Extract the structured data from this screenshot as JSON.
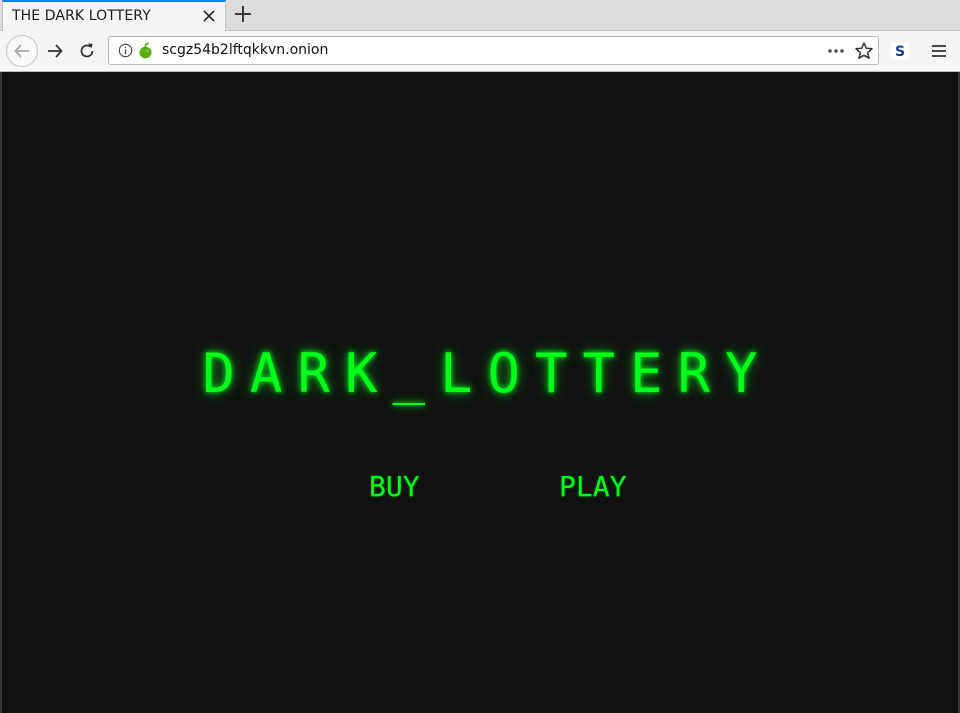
{
  "browser": {
    "tab": {
      "title": "THE DARK LOTTERY"
    },
    "address_bar": {
      "url": "scgz54b2lftqkkvn.onion"
    },
    "extension_label": "S",
    "icons": {
      "close": "close-icon",
      "new_tab": "plus-icon",
      "back": "arrow-left-icon",
      "forward": "arrow-right-icon",
      "reload": "reload-icon",
      "info": "info-icon",
      "onion": "onion-icon",
      "more": "more-dots-icon",
      "bookmark": "star-icon",
      "menu": "hamburger-menu-icon"
    }
  },
  "page": {
    "title": "DARK_LOTTERY",
    "buttons": {
      "buy": "BUY",
      "play": "PLAY"
    },
    "colors": {
      "background": "#121212",
      "accent": "#00ff1a"
    }
  }
}
